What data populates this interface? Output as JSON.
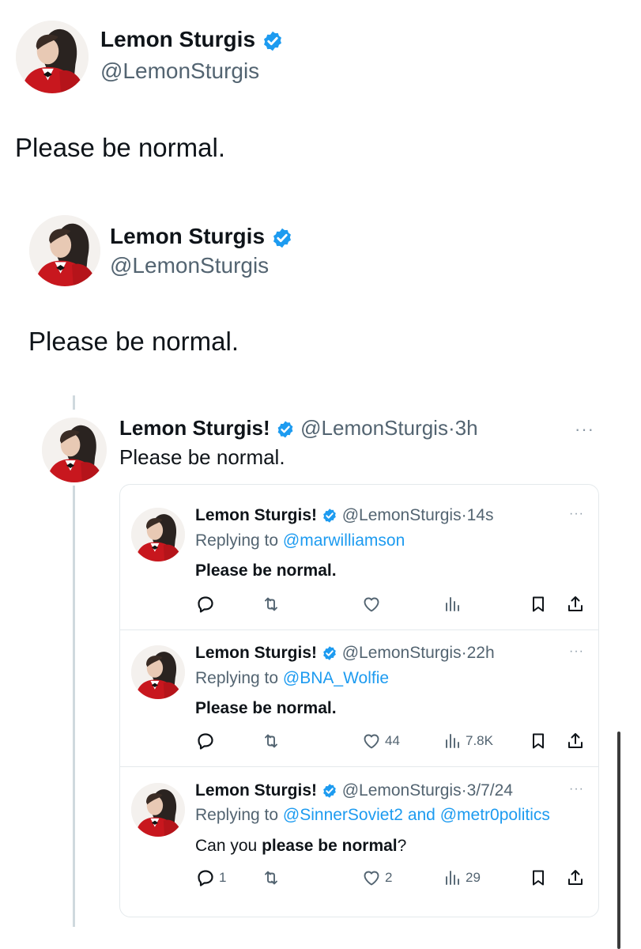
{
  "colors": {
    "accent": "#1d9bf0",
    "muted": "#536471",
    "text": "#0f1419",
    "border": "#e4e9ec"
  },
  "top_tweet": {
    "name": "Lemon Sturgis",
    "handle": "@LemonSturgis",
    "text": "Please be normal."
  },
  "second_tweet": {
    "name": "Lemon Sturgis",
    "handle": "@LemonSturgis",
    "text": "Please be normal."
  },
  "thread_tweet": {
    "name": "Lemon Sturgis!",
    "handle": "@LemonSturgis",
    "time": "3h",
    "text": "Please be normal."
  },
  "replies": [
    {
      "name": "Lemon Sturgis!",
      "handle": "@LemonSturgis",
      "time": "14s",
      "replying_label": "Replying to",
      "replying_to": "@marwilliamson",
      "replying_to_2": "",
      "text_pre": "",
      "text_bold": "Please be normal.",
      "text_post": "",
      "replies": "",
      "likes": "",
      "views": ""
    },
    {
      "name": "Lemon Sturgis!",
      "handle": "@LemonSturgis",
      "time": "22h",
      "replying_label": "Replying to",
      "replying_to": "@BNA_Wolfie",
      "replying_to_2": "",
      "text_pre": "",
      "text_bold": "Please be normal.",
      "text_post": "",
      "replies": "",
      "likes": "44",
      "views": "7.8K"
    },
    {
      "name": "Lemon Sturgis!",
      "handle": "@LemonSturgis",
      "time": "3/7/24",
      "replying_label": "Replying to",
      "replying_to": "@SinnerSoviet2",
      "replying_and": "and",
      "replying_to_2": "@metr0politics",
      "text_pre": "Can you ",
      "text_bold": "please be normal",
      "text_post": "?",
      "replies": "1",
      "likes": "2",
      "views": "29"
    }
  ],
  "icons": [
    "verified-badge-icon",
    "reply-icon",
    "retweet-icon",
    "like-icon",
    "views-icon",
    "bookmark-icon",
    "share-icon",
    "more-icon"
  ],
  "separators": {
    "dot": "·",
    "more": "···"
  }
}
